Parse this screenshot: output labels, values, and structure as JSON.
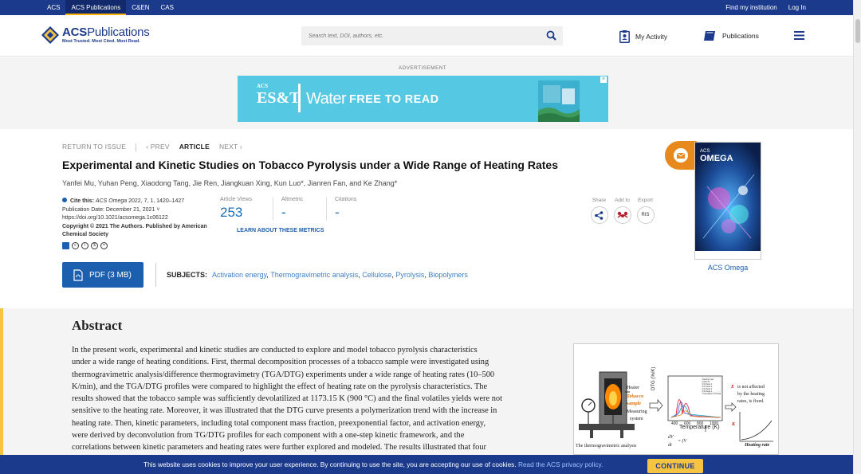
{
  "topbar": {
    "links": [
      "ACS",
      "ACS Publications",
      "C&EN",
      "CAS"
    ],
    "active_index": 1,
    "find_institution": "Find my institution",
    "login": "Log In"
  },
  "header": {
    "logo_name_bold": "ACS",
    "logo_name": "Publications",
    "logo_tagline": "Most Trusted. Most Cited. Most Read.",
    "search_placeholder": "Search text, DOI, authors, etc.",
    "my_activity": "My Activity",
    "publications": "Publications"
  },
  "ad": {
    "label": "ADVERTISEMENT",
    "logo_small": "ACS",
    "logo": "ES&T",
    "sub_brand": "Water",
    "headline": "FREE TO READ"
  },
  "nav": {
    "return": "RETURN TO ISSUE",
    "prev": "‹ PREV",
    "current": "ARTICLE",
    "next": "NEXT ›"
  },
  "article": {
    "title": "Experimental and Kinetic Studies on Tobacco Pyrolysis under a Wide Range of Heating Rates",
    "authors": "Yanfei Mu, Yuhan Peng, Xiaodong Tang, Jie Ren, Jiangkuan Xing, Kun Luo*, Jianren Fan, and Ke Zhang*",
    "cite_label": "Cite this:",
    "cite_journal": "ACS Omega",
    "cite_ref": "2022, 7, 1, 1420–1427",
    "pub_date": "Publication Date: December 21, 2021",
    "doi": "https://doi.org/10.1021/acsomega.1c06122",
    "copyright": "Copyright © 2021 The Authors. Published by American Chemical Society"
  },
  "metrics": {
    "views_label": "Article Views",
    "views": "253",
    "altmetric_label": "Altmetric",
    "altmetric": "-",
    "citations_label": "Citations",
    "citations": "-",
    "learn_more": "LEARN ABOUT THESE METRICS"
  },
  "share": {
    "share_label": "Share",
    "add_label": "Add to",
    "export_label": "Export",
    "export_btn": "RIS"
  },
  "pdf": {
    "label": "PDF (3 MB)"
  },
  "subjects": {
    "label": "SUBJECTS:",
    "items": [
      "Activation energy",
      "Thermogravimetric analysis",
      "Cellulose",
      "Pyrolysis",
      "Biopolymers"
    ]
  },
  "journal": {
    "cover_brand": "ACS",
    "cover_title": "OMEGA",
    "caption": "ACS Omega"
  },
  "abstract": {
    "heading": "Abstract",
    "lines": [
      "In the present work, experimental and kinetic studies are conducted to explore and model tobacco pyrolysis characteristics",
      "under a wide range of heating conditions. First, thermal decomposition processes of a tobacco sample were investigated using",
      "thermogravimetric analysis/difference thermogravimetry (TGA/DTG) experiments under a wide range of heating rates (10–500",
      "K/min), and the TGA/DTG profiles were compared to highlight the effect of heating rate on the pyrolysis characteristics. The",
      "results showed that the tobacco sample was sufficiently devolatilized at 1173.15 K (900 °C) and the final volatiles yields were not",
      "sensitive to the heating rate. Moreover, it was illustrated that the DTG curve presents a polymerization trend with the increase in",
      "heating rate. Then, kinetic parameters, including total component mass fraction, preexponential factor, and activation energy,",
      "were derived by deconvolution from TG/DTG profiles for each component with a one-step kinetic framework, and the",
      "correlations between kinetic parameters and heating rates were further explored and modeled. The results illustrated that four"
    ]
  },
  "toc": {
    "heater": "Heater",
    "tobacco": "Tobacco",
    "sample": "sample",
    "measuring": "Measuring",
    "system": "system",
    "caption": "The thermogravimetric analysis",
    "dtg_axis": "DTG (%/K)",
    "temp_axis": "Temperature (K)",
    "note1": "is not affected",
    "note2": "by the heating",
    "note3": "rates, is fixed.",
    "ea": "E",
    "k": "K",
    "heating_rate": "Heating rate",
    "eq_left": "dV",
    "eq_den": "dt",
    "eq_right": "= (V",
    "legend": [
      "Heating rate 10K/min",
      "FS Peak 1",
      "FS Peak 2",
      "FS Peak 3",
      "FS Peak 4",
      "Cumulative Fit Peak"
    ],
    "ticks": [
      "400",
      "600",
      "800",
      "1000"
    ]
  },
  "cookie": {
    "text": "This website uses cookies to improve your user experience. By continuing to use the site, you are accepting our use of cookies.",
    "link": "Read the ACS privacy policy.",
    "button": "CONTINUE"
  }
}
